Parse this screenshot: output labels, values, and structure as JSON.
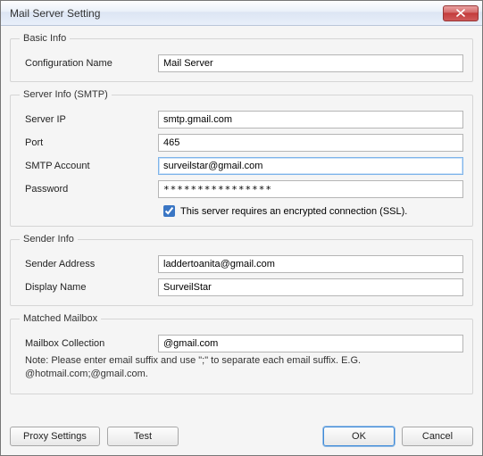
{
  "window": {
    "title": "Mail Server Setting"
  },
  "basic_info": {
    "legend": "Basic Info",
    "config_name_label": "Configuration Name",
    "config_name_value": "Mail Server"
  },
  "server_info": {
    "legend": "Server Info (SMTP)",
    "server_ip_label": "Server IP",
    "server_ip_value": "smtp.gmail.com",
    "port_label": "Port",
    "port_value": "465",
    "smtp_account_label": "SMTP Account",
    "smtp_account_value": "surveilstar@gmail.com",
    "password_label": "Password",
    "password_value": "****************",
    "ssl_checked": true,
    "ssl_label": "This server requires an encrypted connection (SSL)."
  },
  "sender_info": {
    "legend": "Sender Info",
    "sender_address_label": "Sender Address",
    "sender_address_value": "laddertoanita@gmail.com",
    "display_name_label": "Display Name",
    "display_name_value": "SurveilStar"
  },
  "matched_mailbox": {
    "legend": "Matched Mailbox",
    "mailbox_collection_label": "Mailbox Collection",
    "mailbox_collection_value": "@gmail.com",
    "note": "Note: Please enter email suffix and use \";\" to separate each email suffix. E.G. @hotmail.com;@gmail.com."
  },
  "buttons": {
    "proxy": "Proxy Settings",
    "test": "Test",
    "ok": "OK",
    "cancel": "Cancel"
  }
}
